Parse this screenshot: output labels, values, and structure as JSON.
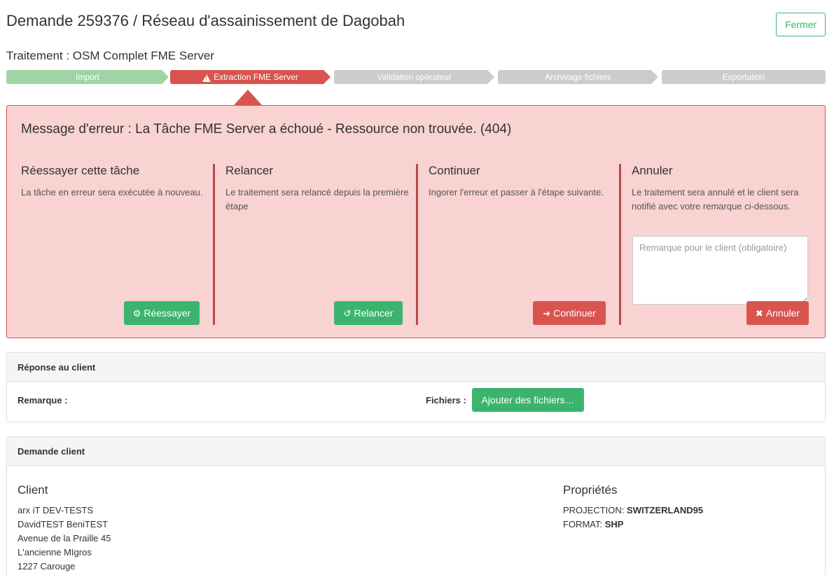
{
  "header": {
    "title": "Demande 259376 / Réseau d'assainissement de Dagobah",
    "close_label": "Fermer",
    "process_title": "Traitement : OSM Complet FME Server"
  },
  "steps": [
    {
      "label": "Import",
      "status": "done"
    },
    {
      "label": "Extraction FME Server",
      "status": "error",
      "icon": "warning-icon"
    },
    {
      "label": "Validation opérateur",
      "status": "pending"
    },
    {
      "label": "Archivage fichiers",
      "status": "pending"
    },
    {
      "label": "Exportation",
      "status": "pending"
    }
  ],
  "error": {
    "message": "Message d'erreur : La Tâche FME Server a échoué - Ressource non trouvée. (404)",
    "options": [
      {
        "title": "Réessayer cette tâche",
        "description": "La tâche en erreur sera exécutée à nouveau.",
        "button": "Réessayer",
        "icon": "gear-icon"
      },
      {
        "title": "Relancer",
        "description": "Le traitement sera relancé depuis la première étape",
        "button": "Relancer",
        "icon": "undo-icon"
      },
      {
        "title": "Continuer",
        "description": "Ingorer l'erreur et passer à l'étape suivante.",
        "button": "Continuer",
        "icon": "arrow-right-icon"
      },
      {
        "title": "Annuler",
        "description": "Le traitement sera annulé et le client sera notifié avec votre remarque ci-dessous.",
        "button": "Annuler",
        "icon": "close-icon",
        "remark_placeholder": "Remarque pour le client (obligatoire)"
      }
    ]
  },
  "response": {
    "heading": "Réponse au client",
    "remark_label": "Remarque :",
    "files_label": "Fichiers :",
    "add_files_label": "Ajouter des fichiers…"
  },
  "request": {
    "heading": "Demande client",
    "client_title": "Client",
    "client_lines": [
      "arx iT DEV-TESTS",
      "DavidTEST BeniTEST",
      "Avenue de la Praille 45",
      "L'ancienne MIgros",
      "1227 Carouge"
    ],
    "properties_title": "Propriétés",
    "properties": [
      {
        "key": "PROJECTION:",
        "value": "SWITZERLAND95"
      },
      {
        "key": "FORMAT:",
        "value": "SHP"
      }
    ]
  },
  "colors": {
    "success": "#3cb46e",
    "danger": "#d9534f",
    "danger_bg": "#f9d2d2",
    "step_done": "#9fd5a5",
    "step_pending": "#cccccc"
  }
}
